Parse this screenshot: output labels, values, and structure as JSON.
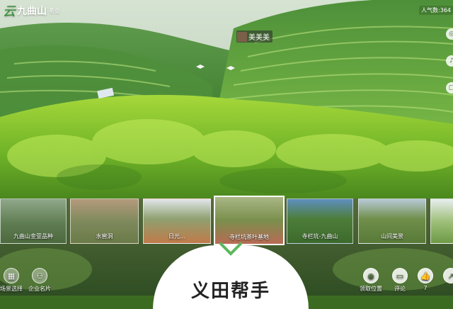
{
  "brand": {
    "mark": "云",
    "name": "九曲山",
    "sub": "茶业"
  },
  "popularity": "人气数:364",
  "hotspot": {
    "label": "美美美"
  },
  "thumbnails": [
    {
      "label": "九曲山金萱品种"
    },
    {
      "label": "水窖洞"
    },
    {
      "label": "日光…"
    },
    {
      "label": "寺栏坑茶叶基地"
    },
    {
      "label": "寺栏坑-九曲山"
    },
    {
      "label": "山间美景"
    },
    {
      "label": ""
    }
  ],
  "active_thumbnail_index": 3,
  "bottom_left": [
    {
      "icon": "scene-select-icon",
      "label": "场景选择"
    },
    {
      "icon": "business-card-icon",
      "label": "企业名片"
    }
  ],
  "center_title": "义田帮手",
  "bottom_right": [
    {
      "icon": "location-icon",
      "label": "领取位置"
    },
    {
      "icon": "comment-icon",
      "label": "评论"
    },
    {
      "icon": "like-icon",
      "label": "7"
    },
    {
      "icon": "share-icon",
      "label": ""
    }
  ],
  "colors": {
    "accent_green": "#4caf50",
    "card_bg": "#ffffff"
  }
}
